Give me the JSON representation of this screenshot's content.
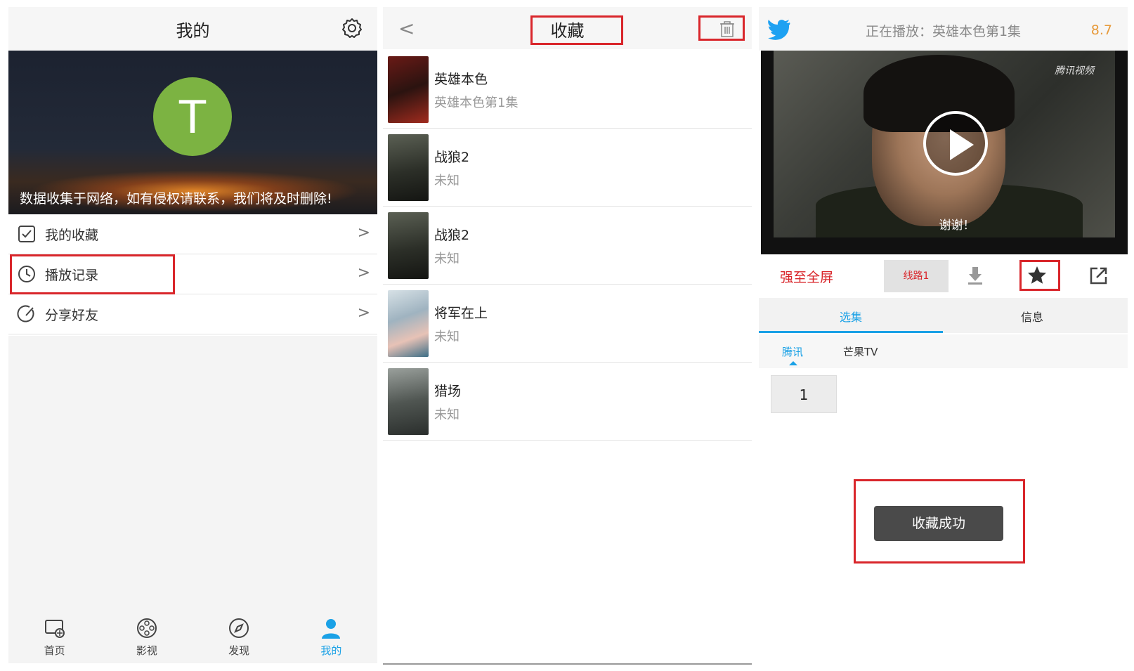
{
  "profile": {
    "title": "我的",
    "avatar_letter": "T",
    "notice": "数据收集于网络，如有侵权请联系，我们将及时删除!",
    "menu": [
      {
        "label": "我的收藏",
        "arrow": ">"
      },
      {
        "label": "播放记录",
        "arrow": ">"
      },
      {
        "label": "分享好友",
        "arrow": ">"
      }
    ],
    "tabbar": [
      {
        "label": "首页"
      },
      {
        "label": "影视"
      },
      {
        "label": "发现"
      },
      {
        "label": "我的"
      }
    ],
    "active_color": "#1aa1e6",
    "avatar_color": "#7cb342"
  },
  "favorites": {
    "back": "<",
    "title": "收藏",
    "items": [
      {
        "title": "英雄本色",
        "subtitle": "英雄本色第1集"
      },
      {
        "title": "战狼2",
        "subtitle": "未知"
      },
      {
        "title": "战狼2",
        "subtitle": "未知"
      },
      {
        "title": "将军在上",
        "subtitle": "未知"
      },
      {
        "title": "猎场",
        "subtitle": "未知"
      }
    ]
  },
  "player": {
    "now_playing": "正在播放：英雄本色第1集",
    "score": "8.7",
    "watermark": "腾讯视频",
    "subtitle": "谢谢！",
    "fullscreen_label": "强至全屏",
    "line_label": "线路1",
    "tabs": [
      {
        "label": "选集"
      },
      {
        "label": "信息"
      }
    ],
    "sources": [
      {
        "label": "腾讯"
      },
      {
        "label": "芒果TV"
      }
    ],
    "episode": "1",
    "toast": "收藏成功",
    "accent": "#1aa1e6",
    "highlight_red": "#d9262b"
  }
}
